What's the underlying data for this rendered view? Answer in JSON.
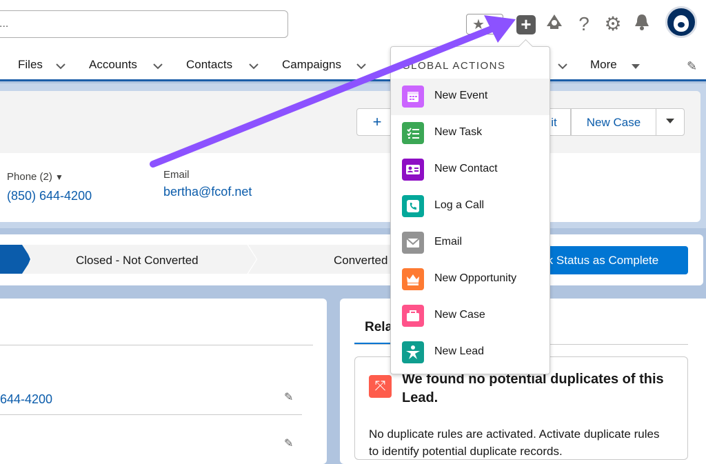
{
  "header": {
    "search_text": "..."
  },
  "nav": {
    "items": [
      {
        "label": "Files",
        "icon": "chevron-down-icon"
      },
      {
        "label": "Accounts",
        "icon": "chevron-down-icon"
      },
      {
        "label": "Contacts",
        "icon": "chevron-down-icon"
      },
      {
        "label": "Campaigns",
        "icon": "chevron-down-icon"
      },
      {
        "label": "More",
        "icon": "caret-down-icon"
      }
    ]
  },
  "record": {
    "actions": {
      "new_case": "New Case",
      "partial_edit": "it"
    },
    "phone_label": "Phone (2)",
    "phone_value": "(850) 644-4200",
    "email_label": "Email",
    "email_value": "bertha@fcof.net"
  },
  "path": {
    "steps": [
      "Closed - Not Converted",
      "Converted"
    ],
    "mark_button": "rk Status as Complete"
  },
  "details": {
    "phone_value": "644-4200"
  },
  "related": {
    "tab": "Rela",
    "dup_title": "We found no potential duplicates of this Lead.",
    "dup_text": "No duplicate rules are activated. Activate duplicate rules to identify potential duplicate records."
  },
  "global_actions": {
    "heading": "GLOBAL ACTIONS",
    "items": [
      {
        "label": "New Event",
        "icon": "calendar-icon",
        "color": "#cb65ff"
      },
      {
        "label": "New Task",
        "icon": "task-checklist-icon",
        "color": "#3ba755"
      },
      {
        "label": "New Contact",
        "icon": "contact-card-icon",
        "color": "#a094ed"
      },
      {
        "label": "Log a Call",
        "icon": "phone-icon",
        "color": "#0d9dda"
      },
      {
        "label": "Email",
        "icon": "envelope-icon",
        "color": "#939393"
      },
      {
        "label": "New Opportunity",
        "icon": "crown-icon",
        "color": "#fe5c4c"
      },
      {
        "label": "New Case",
        "icon": "briefcase-icon",
        "color": "#ff538a"
      },
      {
        "label": "New Lead",
        "icon": "person-star-icon",
        "color": "#1b96b4"
      }
    ]
  },
  "colors": {
    "brand_blue": "#0176d3",
    "annotation_arrow": "#8c52ff"
  }
}
